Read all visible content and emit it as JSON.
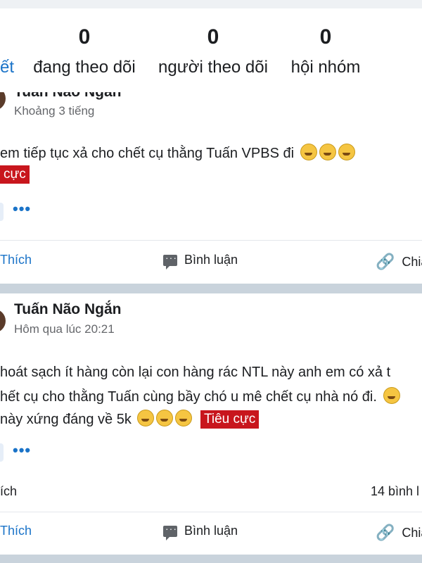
{
  "stats": {
    "partial_label": "ết",
    "items": [
      {
        "count": "0",
        "label": "đang theo dõi"
      },
      {
        "count": "0",
        "label": "người theo dõi"
      },
      {
        "count": "0",
        "label": "hội nhóm"
      }
    ]
  },
  "posts": [
    {
      "author": "Tuấn Não Ngắn",
      "time": "Khoảng 3 tiếng",
      "content_line1": "em tiếp tục xả cho chết cụ thằng Tuấn VPBS đi",
      "tag": "cực",
      "more": "•••",
      "actions": {
        "like": "Thích",
        "comment": "Bình luận",
        "share": "Chia"
      }
    },
    {
      "author": "Tuấn Não Ngắn",
      "time": "Hôm qua lúc 20:21",
      "content_line1": "hoát sạch ít hàng còn lại con hàng rác NTL này anh em có xả t",
      "content_line2": "hết cụ cho thằng Tuấn cùng bầy chó u mê chết cụ nhà nó đi.",
      "content_line3": "này xứng đáng về 5k",
      "tag": "Tiêu cực",
      "more": "•••",
      "reactions_partial": "ích",
      "comment_count": "14 bình l",
      "actions": {
        "like": "Thích",
        "comment": "Bình luận",
        "share": "Chia"
      }
    }
  ],
  "colors": {
    "accent": "#1a73c8",
    "negative_tag": "#c8161d",
    "background": "#c9d3dc"
  },
  "icons": {
    "comment": "comment-icon",
    "share": "link-icon",
    "emoji": "grinning-face-icon"
  }
}
